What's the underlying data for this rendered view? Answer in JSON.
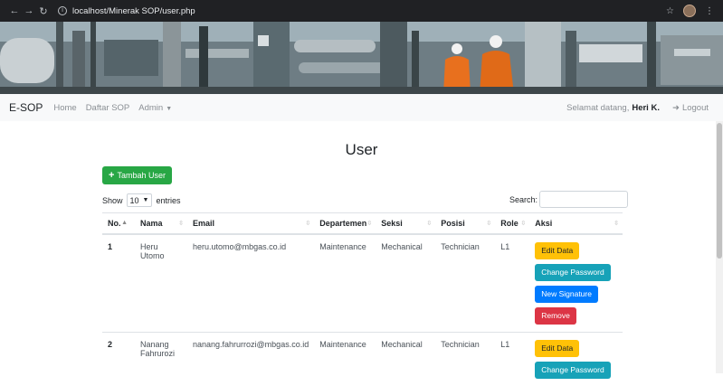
{
  "browser": {
    "url": "localhost/Minerak SOP/user.php",
    "back_icon": "arrow-left",
    "forward_icon": "arrow-right",
    "reload_icon": "reload",
    "star_icon": "star"
  },
  "navbar": {
    "brand": "E-SOP",
    "links": [
      "Home",
      "Daftar SOP",
      "Admin"
    ],
    "welcome": "Selamat datang,",
    "user": "Heri K.",
    "logout": "Logout"
  },
  "page": {
    "title": "User",
    "add_button": "Tambah User",
    "show_label": "Show",
    "entries_value": "10",
    "entries_label": "entries",
    "search_label": "Search:"
  },
  "table": {
    "headers": [
      "No.",
      "Nama",
      "Email",
      "Departemen",
      "Seksi",
      "Posisi",
      "Role",
      "Aksi"
    ],
    "rows": [
      {
        "no": "1",
        "nama": "Heru Utomo",
        "email": "heru.utomo@mbgas.co.id",
        "departemen": "Maintenance",
        "seksi": "Mechanical",
        "posisi": "Technician",
        "role": "L1",
        "actions": [
          "Edit Data",
          "Change Password",
          "New Signature",
          "Remove"
        ]
      },
      {
        "no": "2",
        "nama": "Nanang Fahrurozi",
        "email": "nanang.fahrurrozi@mbgas.co.id",
        "departemen": "Maintenance",
        "seksi": "Mechanical",
        "posisi": "Technician",
        "role": "L1",
        "actions": [
          "Edit Data",
          "Change Password"
        ]
      }
    ]
  },
  "colors": {
    "success": "#28a745",
    "warning": "#ffc107",
    "info": "#17a2b8",
    "primary": "#007bff",
    "danger": "#dc3545"
  }
}
